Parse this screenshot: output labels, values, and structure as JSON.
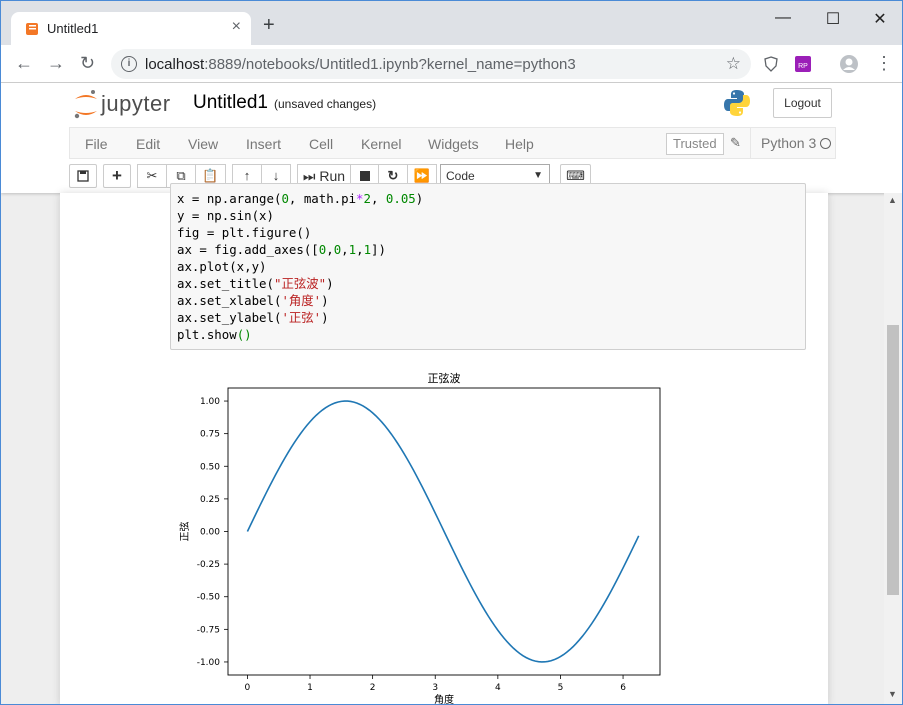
{
  "browser": {
    "tab_title": "Untitled1",
    "tab_close": "×",
    "new_tab": "+",
    "window_controls": [
      "—",
      "☐",
      "✕"
    ],
    "url_host": "localhost",
    "url_rest": ":8889/notebooks/Untitled1.ipynb?kernel_name=python3",
    "accent_color": "#4a8ad6"
  },
  "jupyter": {
    "logo_text": "jupyter",
    "notebook_name": "Untitled1",
    "save_status": "(unsaved changes)",
    "logout_label": "Logout",
    "menu": [
      "File",
      "Edit",
      "View",
      "Insert",
      "Cell",
      "Kernel",
      "Widgets",
      "Help"
    ],
    "trusted_label": "Trusted",
    "kernel_label": "Python 3",
    "run_label": "Run",
    "cell_type": "Code"
  },
  "code_lines": [
    [
      {
        "t": "x = np.arange("
      },
      {
        "t": "0",
        "c": "n"
      },
      {
        "t": ", math.pi"
      },
      {
        "t": "*",
        "c": "p"
      },
      {
        "t": "2",
        "c": "n"
      },
      {
        "t": ", "
      },
      {
        "t": "0.05",
        "c": "n"
      },
      {
        "t": ")"
      }
    ],
    [
      {
        "t": "y = np.sin(x)"
      }
    ],
    [
      {
        "t": "fig = plt.figure()"
      }
    ],
    [
      {
        "t": "ax = fig.add_axes(["
      },
      {
        "t": "0",
        "c": "n"
      },
      {
        "t": ","
      },
      {
        "t": "0",
        "c": "n"
      },
      {
        "t": ","
      },
      {
        "t": "1",
        "c": "n"
      },
      {
        "t": ","
      },
      {
        "t": "1",
        "c": "n"
      },
      {
        "t": "])"
      }
    ],
    [
      {
        "t": "ax.plot(x,y)"
      }
    ],
    [
      {
        "t": "ax.set_title("
      },
      {
        "t": "\"正弦波\"",
        "c": "s"
      },
      {
        "t": ")"
      }
    ],
    [
      {
        "t": "ax.set_xlabel("
      },
      {
        "t": "'角度'",
        "c": "s"
      },
      {
        "t": ")"
      }
    ],
    [
      {
        "t": "ax.set_ylabel("
      },
      {
        "t": "'正弦'",
        "c": "s"
      },
      {
        "t": ")"
      }
    ],
    [
      {
        "t": "plt.show"
      },
      {
        "t": "()",
        "c": "n"
      }
    ]
  ],
  "chart_data": {
    "type": "line",
    "title": "正弦波",
    "xlabel": "角度",
    "ylabel": "正弦",
    "xlim": [
      -0.31,
      6.59
    ],
    "ylim": [
      -1.1,
      1.1
    ],
    "xticks": [
      0,
      1,
      2,
      3,
      4,
      5,
      6
    ],
    "yticks": [
      1.0,
      0.75,
      0.5,
      0.25,
      0.0,
      -0.25,
      -0.5,
      -0.75,
      -1.0
    ],
    "ytick_labels": [
      "1.00",
      "0.75",
      "0.50",
      "0.25",
      "0.00",
      "-0.25",
      "-0.50",
      "-0.75",
      "-1.00"
    ],
    "series": [
      {
        "function": "sin",
        "x_start": 0,
        "x_end": 6.25,
        "x_step": 0.05,
        "color": "#1f77b4"
      }
    ],
    "grid": false
  }
}
